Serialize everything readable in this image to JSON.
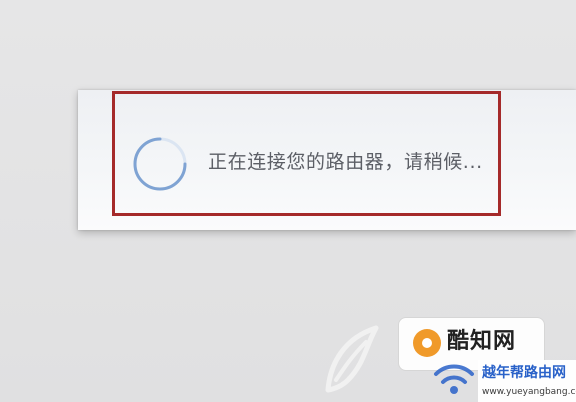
{
  "dialog": {
    "status_text": "正在连接您的路由器，请稍候...",
    "spinner_icon": "loading-spinner-icon",
    "highlight_color": "#a52a2a",
    "spinner_color": "#7fa3d3"
  },
  "watermarks": {
    "badge_text": "酷知网",
    "site_name": "越年帮路由网",
    "site_url": "www.yueyangbang.com",
    "badge_icon": "orange-circle-logo-icon",
    "feather_icon": "feather-logo-icon",
    "wifi_icon": "wifi-icon"
  }
}
